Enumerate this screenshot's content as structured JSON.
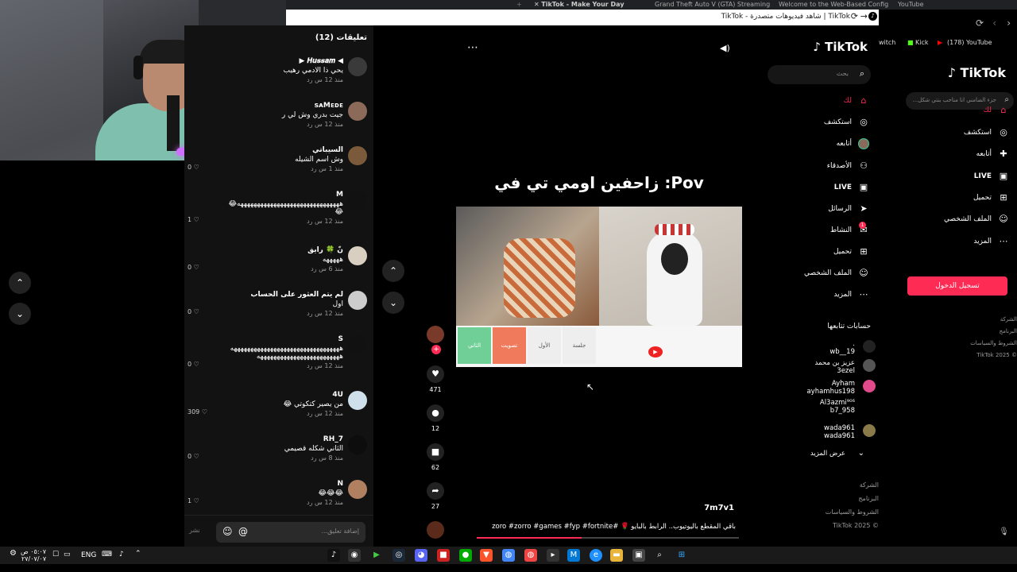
{
  "bg_browser": {
    "tabs": [
      {
        "title": "TikTok - Make Your Day",
        "active": true
      },
      {
        "title": "Grand Theft Auto V (GTA) Streaming",
        "active": false
      },
      {
        "title": "Welcome to the Web-Based Config",
        "active": false
      },
      {
        "title": "YouTube",
        "active": false
      }
    ],
    "bookmarks": [
      {
        "label": "witch"
      },
      {
        "label": "Kick"
      },
      {
        "label": "(178) YouTube"
      }
    ],
    "logo": "TikTok",
    "search_placeholder": "جزء الضامني انا مناحب بنتي شكل...",
    "nav": [
      {
        "label": "لك",
        "icon": "home-icon"
      },
      {
        "label": "استكشف",
        "icon": "compass-icon"
      },
      {
        "label": "أتابعه",
        "icon": "user-plus-icon"
      },
      {
        "label": "LIVE",
        "icon": "live-icon"
      },
      {
        "label": "تحميل",
        "icon": "upload-icon"
      },
      {
        "label": "الملف الشخصي",
        "icon": "profile-icon"
      },
      {
        "label": "المزيد",
        "icon": "more-icon"
      }
    ],
    "login_button": "تسجيل الدخول",
    "footer": [
      "الشركة",
      "البرنامج",
      "الشروط والسياسات",
      "© TikTok 2025"
    ]
  },
  "window": {
    "title": "TikTok | شاهد فيديوهات متصدرة - TikTok",
    "accent": "#fe2c55"
  },
  "comments": {
    "header": "تعليقات (12)",
    "reply_label": "رد",
    "input_placeholder": "إضافة تعليق...",
    "post_label": "نشر",
    "items": [
      {
        "name": "◀ 𝑯𝒖𝒔𝒔𝒂𝒎 ▶",
        "text": "يحي ذا الادمي رهيب",
        "time": "منذ 12 س",
        "likes": ""
      },
      {
        "name": "sᴀMᴇᴅᴇ",
        "text": "جيت بدري وش لي ر",
        "time": "منذ 12 س",
        "likes": ""
      },
      {
        "name": "السيباتي",
        "text": "وش اسم الشيله",
        "time": "منذ 1 س",
        "likes": "0"
      },
      {
        "name": "M",
        "text": "هههههههههههههههههههههههههههههههه😂",
        "text2": "😂",
        "time": "منذ 12 س",
        "likes": "1"
      },
      {
        "name": "نّ 🍀 رايق",
        "text": "هههههه",
        "time": "منذ 6 س",
        "likes": "0"
      },
      {
        "name": "لم يتم العثور على الحساب",
        "text": "اول",
        "time": "منذ 12 س",
        "likes": "0"
      },
      {
        "name": "S",
        "text": "هههههههههههههههههههههههههههههههههه",
        "text2": "هههههههههههههههههههههههههه",
        "time": "منذ 12 س",
        "likes": "0"
      },
      {
        "name": "4U",
        "text": "من يصير كتكوتي 😂",
        "time": "منذ 12 س",
        "likes": "309"
      },
      {
        "name": "RH_7",
        "text": "الثاني شكله قصيمي",
        "time": "منذ 8 س",
        "likes": "0"
      },
      {
        "name": "N",
        "text": "😂😂😂",
        "time": "منذ 12 س",
        "likes": "1"
      }
    ]
  },
  "video": {
    "caption_overlay": "Pov: زاحفين اومي تي في",
    "author": "7m7v1",
    "description": "باقي المقطع باليوتيوب.. الرابط بالبايو 🌹 #zoro #zorro #games #fyp #fortnite",
    "likes": "471",
    "comments": "12",
    "saves": "62",
    "shares": "27",
    "card_labels": [
      "الثاني",
      "تصويت",
      "الأول",
      "جلسة"
    ]
  },
  "nav": {
    "logo": "TikTok",
    "search_placeholder": "بحث",
    "items": [
      {
        "label": "لك",
        "icon": "home-icon",
        "active": true
      },
      {
        "label": "استكشف",
        "icon": "compass-icon"
      },
      {
        "label": "أتابعه",
        "icon": "following-avatar-icon"
      },
      {
        "label": "الأصدقاء",
        "icon": "friends-icon"
      },
      {
        "label": "LIVE",
        "icon": "live-icon"
      },
      {
        "label": "الرسائل",
        "icon": "messages-icon"
      },
      {
        "label": "النشاط",
        "icon": "activity-icon",
        "badge": "1"
      },
      {
        "label": "تحميل",
        "icon": "upload-icon"
      },
      {
        "label": "الملف الشخصي",
        "icon": "profile-icon"
      },
      {
        "label": "المزيد",
        "icon": "more-icon"
      }
    ],
    "following_header": "حسابات تتابعها",
    "following": [
      {
        "name": ".",
        "handle": "wb__19"
      },
      {
        "name": "عزيز بن محمد",
        "handle": "3ezel"
      },
      {
        "name": "Ayham",
        "handle": "ayhamhus198"
      },
      {
        "name": "Al3azmi⁹⁰⁶",
        "handle": "b7_958"
      },
      {
        "name": "wada961",
        "handle": "wada961"
      }
    ],
    "see_more": "عرض المزيد",
    "footer": [
      "الشركة",
      "البرنامج",
      "الشروط والسياسات",
      "© TikTok 2025"
    ]
  },
  "taskbar": {
    "time": "٠٥:٠٧ ص",
    "date": "٢٧/٠٧/٠٧",
    "lang": "ENG"
  }
}
